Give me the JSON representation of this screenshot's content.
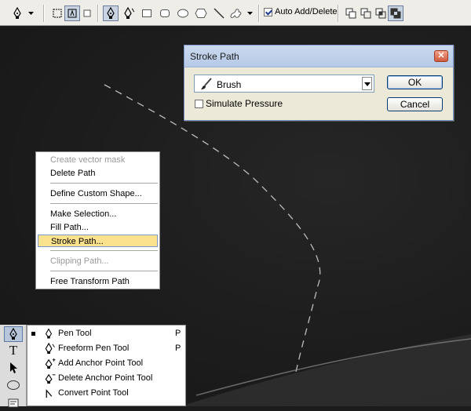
{
  "options_bar": {
    "auto_add_label": "Auto Add/Delete",
    "auto_add_checked": true
  },
  "dialog": {
    "title": "Stroke Path",
    "close_glyph": "✕",
    "tool_selected": "Brush",
    "simulate_label": "Simulate Pressure",
    "simulate_checked": false,
    "ok_label": "OK",
    "cancel_label": "Cancel"
  },
  "context_menu": {
    "items": [
      {
        "label": "Create vector mask",
        "disabled": true
      },
      {
        "label": "Delete Path",
        "disabled": false
      },
      {
        "label": "Define Custom Shape...",
        "disabled": false
      },
      {
        "label": "Make Selection...",
        "disabled": false
      },
      {
        "label": "Fill Path...",
        "disabled": false
      },
      {
        "label": "Stroke Path...",
        "disabled": false,
        "highlighted": true
      },
      {
        "label": "Clipping Path...",
        "disabled": true
      },
      {
        "label": "Free Transform Path",
        "disabled": false
      }
    ]
  },
  "tools_panel": {
    "type_tool_glyph": "T"
  },
  "tool_flyout": {
    "items": [
      {
        "label": "Pen Tool",
        "shortcut": "P",
        "active": true,
        "icon": "pen-icon"
      },
      {
        "label": "Freeform Pen Tool",
        "shortcut": "P",
        "active": false,
        "icon": "freeform-pen-icon"
      },
      {
        "label": "Add Anchor Point Tool",
        "shortcut": "",
        "active": false,
        "icon": "add-anchor-icon"
      },
      {
        "label": "Delete Anchor Point Tool",
        "shortcut": "",
        "active": false,
        "icon": "delete-anchor-icon"
      },
      {
        "label": "Convert Point Tool",
        "shortcut": "",
        "active": false,
        "icon": "convert-point-icon"
      }
    ]
  }
}
